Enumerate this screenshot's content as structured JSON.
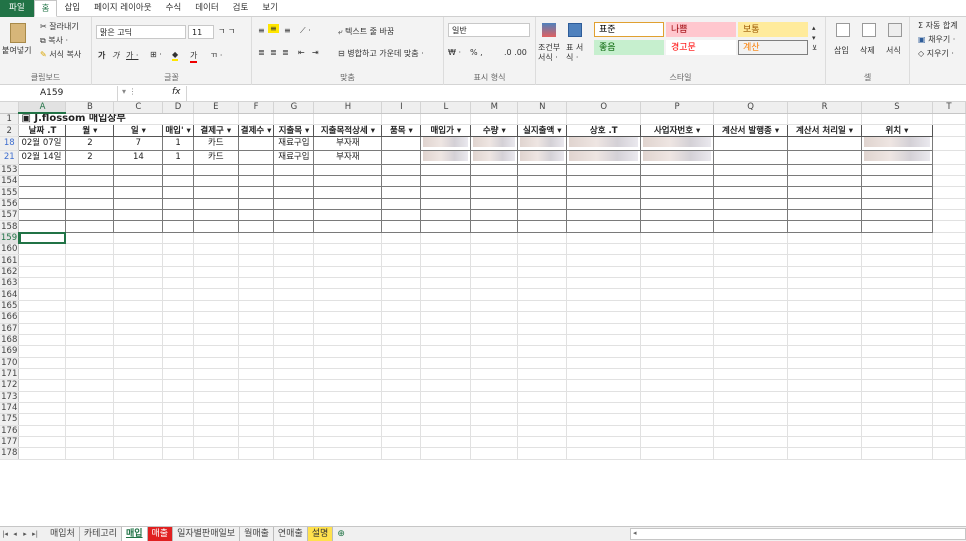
{
  "menu": [
    "파일",
    "홈",
    "삽입",
    "페이지 레이아웃",
    "수식",
    "데이터",
    "검토",
    "보기"
  ],
  "ribbon": {
    "paste": "붙여넣기",
    "cut": "잘라내기",
    "copy": "복사 ·",
    "format_painter": "서식 복사",
    "clipboard": "클립보드",
    "font_name": "맑은 고딕",
    "font_size": "11",
    "font_group": "글꼴",
    "wrap": "텍스트 줄 바꿈",
    "merge": "병합하고 가운데 맞춤 ·",
    "align_group": "맞춤",
    "number_format": "일반",
    "number_group": "표시 형식",
    "percent": "% ,",
    "cond_format": "조건부 서식 ·",
    "table_format": "표 서식 ·",
    "styles": [
      {
        "label": "표준",
        "bg": "#ffffff",
        "fg": "#000000",
        "border": "#e0a030"
      },
      {
        "label": "나쁨",
        "bg": "#ffc7ce",
        "fg": "#9c0006",
        "border": "#ffc7ce"
      },
      {
        "label": "보통",
        "bg": "#ffeb9c",
        "fg": "#9c5700",
        "border": "#ffeb9c"
      },
      {
        "label": "좋음",
        "bg": "#c6efce",
        "fg": "#006100",
        "border": "#c6efce"
      },
      {
        "label": "경고문",
        "bg": "#ffffff",
        "fg": "#ff0000",
        "border": "#ffffff"
      },
      {
        "label": "계산",
        "bg": "#f2f2f2",
        "fg": "#fa7d00",
        "border": "#7f7f7f"
      }
    ],
    "style_group": "스타일",
    "insert": "삽입",
    "delete": "삭제",
    "format": "서식",
    "cells_group": "셀",
    "autosum": "Σ 자동 합계",
    "fill": "채우기 ·",
    "clear": "지우기 ·"
  },
  "formula_bar": {
    "name_box": "A159",
    "fx": "fx"
  },
  "columns": [
    "A",
    "B",
    "C",
    "D",
    "E",
    "F",
    "G",
    "H",
    "I",
    "L",
    "M",
    "N",
    "O",
    "P",
    "Q",
    "R",
    "S",
    "T"
  ],
  "title": "▣ J.flossom 매입장부",
  "headers": [
    "날짜 .T",
    "월 ▾",
    "일 ▾",
    "매입' ▾",
    "결제구 ▾",
    "결제수 ▾",
    "지출목 ▾",
    "지출목적상세 ▾",
    "품목 ▾",
    "매입가 ▾",
    "수량 ▾",
    "실지출액 ▾",
    "상호 .T",
    "사업자번호 ▾",
    "계산서 발행종 ▾",
    "계산서 처리일 ▾",
    "위치 ▾"
  ],
  "rows": [
    {
      "rownum": "18",
      "cells": [
        "02월 07일",
        "2",
        "7",
        "1",
        "카드",
        "",
        "재료구입",
        "부자재",
        "",
        "",
        "",
        "",
        "",
        "",
        "",
        "",
        ""
      ]
    },
    {
      "rownum": "21",
      "cells": [
        "02월 14일",
        "2",
        "14",
        "1",
        "카드",
        "",
        "재료구입",
        "부자재",
        "",
        "",
        "",
        "",
        "",
        "",
        "",
        "",
        ""
      ]
    }
  ],
  "empty_table_rows": [
    "153",
    "154",
    "155",
    "156",
    "157",
    "158"
  ],
  "after_rows": [
    "159",
    "160",
    "161",
    "162",
    "163",
    "164",
    "165",
    "166",
    "167",
    "168",
    "169",
    "170",
    "171",
    "172",
    "173",
    "174",
    "175",
    "176",
    "177",
    "178"
  ],
  "sheet_tabs": [
    {
      "label": "매입처",
      "kind": "normal"
    },
    {
      "label": "카테고리",
      "kind": "normal"
    },
    {
      "label": "매입",
      "kind": "active"
    },
    {
      "label": "매출",
      "kind": "red"
    },
    {
      "label": "일자별판매일보",
      "kind": "normal"
    },
    {
      "label": "월매출",
      "kind": "normal"
    },
    {
      "label": "연매출",
      "kind": "normal"
    },
    {
      "label": "설명",
      "kind": "yellow"
    }
  ]
}
